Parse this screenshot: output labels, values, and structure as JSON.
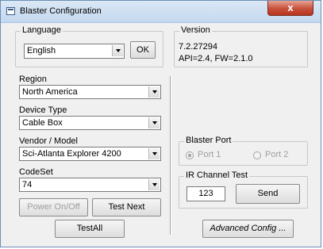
{
  "window": {
    "title": "Blaster Configuration",
    "close_glyph": "x"
  },
  "language": {
    "legend": "Language",
    "selected": "English",
    "ok_label": "OK"
  },
  "version": {
    "legend": "Version",
    "line1": "7.2.27294",
    "line2": "API=2.4, FW=2.1.0"
  },
  "region": {
    "label": "Region",
    "selected": "North America"
  },
  "device_type": {
    "label": "Device Type",
    "selected": "Cable Box"
  },
  "vendor_model": {
    "label": "Vendor / Model",
    "selected": "Sci-Atlanta Explorer 4200"
  },
  "codeset": {
    "label": "CodeSet",
    "selected": "74"
  },
  "buttons": {
    "power": "Power On/Off",
    "test_next": "Test Next",
    "test_all": "TestAll",
    "advanced": "Advanced Config ..."
  },
  "blaster_port": {
    "legend": "Blaster Port",
    "port1": "Port 1",
    "port2": "Port 2",
    "selected": "Port 1"
  },
  "ir_test": {
    "legend": "IR Channel Test",
    "channel_value": "123",
    "send_label": "Send"
  },
  "icons": {
    "window": "app-window-icon",
    "close": "close-icon",
    "dropdown": "chevron-down-icon"
  },
  "colors": {
    "title_bar": "#c3d8ef",
    "close": "#c7503b",
    "dialog_bg": "#f0f0f0"
  }
}
